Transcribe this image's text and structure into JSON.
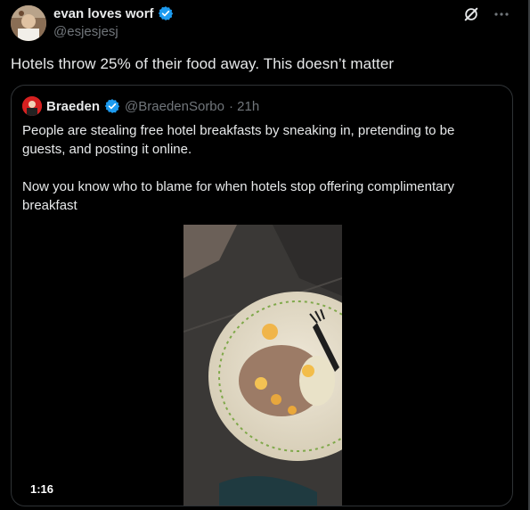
{
  "author": {
    "name": "evan loves worf",
    "handle": "@esjesjesj",
    "verified": true
  },
  "tweet": {
    "text": "Hotels throw 25% of their food away. This doesn’t matter"
  },
  "quote": {
    "author_name": "Braeden",
    "author_handle": "@BraedenSorbo",
    "time": "· 21h",
    "verified": true,
    "paragraphs": [
      "People are stealing free hotel breakfasts by sneaking in, pretending to be guests, and posting it online.",
      "Now you know who to blame for when hotels stop offering complimentary breakfast"
    ],
    "video": {
      "duration": "1:16"
    }
  },
  "colors": {
    "background": "#000000",
    "text": "#e7e9ea",
    "muted": "#71767b",
    "verified_blue": "#1d9bf0",
    "border": "#2f3336"
  },
  "icons": [
    "grok-icon",
    "more-icon",
    "verified-badge-icon"
  ]
}
